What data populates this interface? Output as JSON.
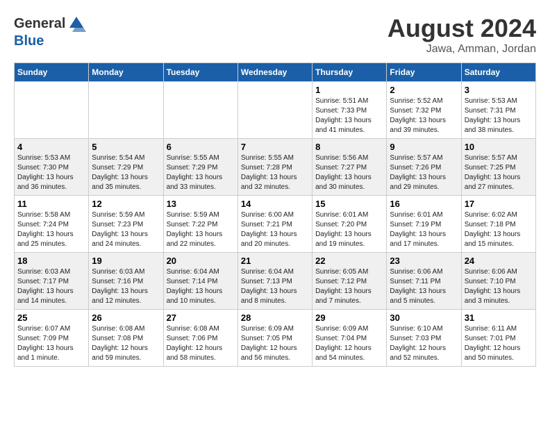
{
  "header": {
    "logo_line1": "General",
    "logo_line2": "Blue",
    "month_year": "August 2024",
    "location": "Jawa, Amman, Jordan"
  },
  "days_of_week": [
    "Sunday",
    "Monday",
    "Tuesday",
    "Wednesday",
    "Thursday",
    "Friday",
    "Saturday"
  ],
  "weeks": [
    [
      {
        "day": "",
        "info": ""
      },
      {
        "day": "",
        "info": ""
      },
      {
        "day": "",
        "info": ""
      },
      {
        "day": "",
        "info": ""
      },
      {
        "day": "1",
        "info": "Sunrise: 5:51 AM\nSunset: 7:33 PM\nDaylight: 13 hours\nand 41 minutes."
      },
      {
        "day": "2",
        "info": "Sunrise: 5:52 AM\nSunset: 7:32 PM\nDaylight: 13 hours\nand 39 minutes."
      },
      {
        "day": "3",
        "info": "Sunrise: 5:53 AM\nSunset: 7:31 PM\nDaylight: 13 hours\nand 38 minutes."
      }
    ],
    [
      {
        "day": "4",
        "info": "Sunrise: 5:53 AM\nSunset: 7:30 PM\nDaylight: 13 hours\nand 36 minutes."
      },
      {
        "day": "5",
        "info": "Sunrise: 5:54 AM\nSunset: 7:29 PM\nDaylight: 13 hours\nand 35 minutes."
      },
      {
        "day": "6",
        "info": "Sunrise: 5:55 AM\nSunset: 7:29 PM\nDaylight: 13 hours\nand 33 minutes."
      },
      {
        "day": "7",
        "info": "Sunrise: 5:55 AM\nSunset: 7:28 PM\nDaylight: 13 hours\nand 32 minutes."
      },
      {
        "day": "8",
        "info": "Sunrise: 5:56 AM\nSunset: 7:27 PM\nDaylight: 13 hours\nand 30 minutes."
      },
      {
        "day": "9",
        "info": "Sunrise: 5:57 AM\nSunset: 7:26 PM\nDaylight: 13 hours\nand 29 minutes."
      },
      {
        "day": "10",
        "info": "Sunrise: 5:57 AM\nSunset: 7:25 PM\nDaylight: 13 hours\nand 27 minutes."
      }
    ],
    [
      {
        "day": "11",
        "info": "Sunrise: 5:58 AM\nSunset: 7:24 PM\nDaylight: 13 hours\nand 25 minutes."
      },
      {
        "day": "12",
        "info": "Sunrise: 5:59 AM\nSunset: 7:23 PM\nDaylight: 13 hours\nand 24 minutes."
      },
      {
        "day": "13",
        "info": "Sunrise: 5:59 AM\nSunset: 7:22 PM\nDaylight: 13 hours\nand 22 minutes."
      },
      {
        "day": "14",
        "info": "Sunrise: 6:00 AM\nSunset: 7:21 PM\nDaylight: 13 hours\nand 20 minutes."
      },
      {
        "day": "15",
        "info": "Sunrise: 6:01 AM\nSunset: 7:20 PM\nDaylight: 13 hours\nand 19 minutes."
      },
      {
        "day": "16",
        "info": "Sunrise: 6:01 AM\nSunset: 7:19 PM\nDaylight: 13 hours\nand 17 minutes."
      },
      {
        "day": "17",
        "info": "Sunrise: 6:02 AM\nSunset: 7:18 PM\nDaylight: 13 hours\nand 15 minutes."
      }
    ],
    [
      {
        "day": "18",
        "info": "Sunrise: 6:03 AM\nSunset: 7:17 PM\nDaylight: 13 hours\nand 14 minutes."
      },
      {
        "day": "19",
        "info": "Sunrise: 6:03 AM\nSunset: 7:16 PM\nDaylight: 13 hours\nand 12 minutes."
      },
      {
        "day": "20",
        "info": "Sunrise: 6:04 AM\nSunset: 7:14 PM\nDaylight: 13 hours\nand 10 minutes."
      },
      {
        "day": "21",
        "info": "Sunrise: 6:04 AM\nSunset: 7:13 PM\nDaylight: 13 hours\nand 8 minutes."
      },
      {
        "day": "22",
        "info": "Sunrise: 6:05 AM\nSunset: 7:12 PM\nDaylight: 13 hours\nand 7 minutes."
      },
      {
        "day": "23",
        "info": "Sunrise: 6:06 AM\nSunset: 7:11 PM\nDaylight: 13 hours\nand 5 minutes."
      },
      {
        "day": "24",
        "info": "Sunrise: 6:06 AM\nSunset: 7:10 PM\nDaylight: 13 hours\nand 3 minutes."
      }
    ],
    [
      {
        "day": "25",
        "info": "Sunrise: 6:07 AM\nSunset: 7:09 PM\nDaylight: 13 hours\nand 1 minute."
      },
      {
        "day": "26",
        "info": "Sunrise: 6:08 AM\nSunset: 7:08 PM\nDaylight: 12 hours\nand 59 minutes."
      },
      {
        "day": "27",
        "info": "Sunrise: 6:08 AM\nSunset: 7:06 PM\nDaylight: 12 hours\nand 58 minutes."
      },
      {
        "day": "28",
        "info": "Sunrise: 6:09 AM\nSunset: 7:05 PM\nDaylight: 12 hours\nand 56 minutes."
      },
      {
        "day": "29",
        "info": "Sunrise: 6:09 AM\nSunset: 7:04 PM\nDaylight: 12 hours\nand 54 minutes."
      },
      {
        "day": "30",
        "info": "Sunrise: 6:10 AM\nSunset: 7:03 PM\nDaylight: 12 hours\nand 52 minutes."
      },
      {
        "day": "31",
        "info": "Sunrise: 6:11 AM\nSunset: 7:01 PM\nDaylight: 12 hours\nand 50 minutes."
      }
    ]
  ]
}
